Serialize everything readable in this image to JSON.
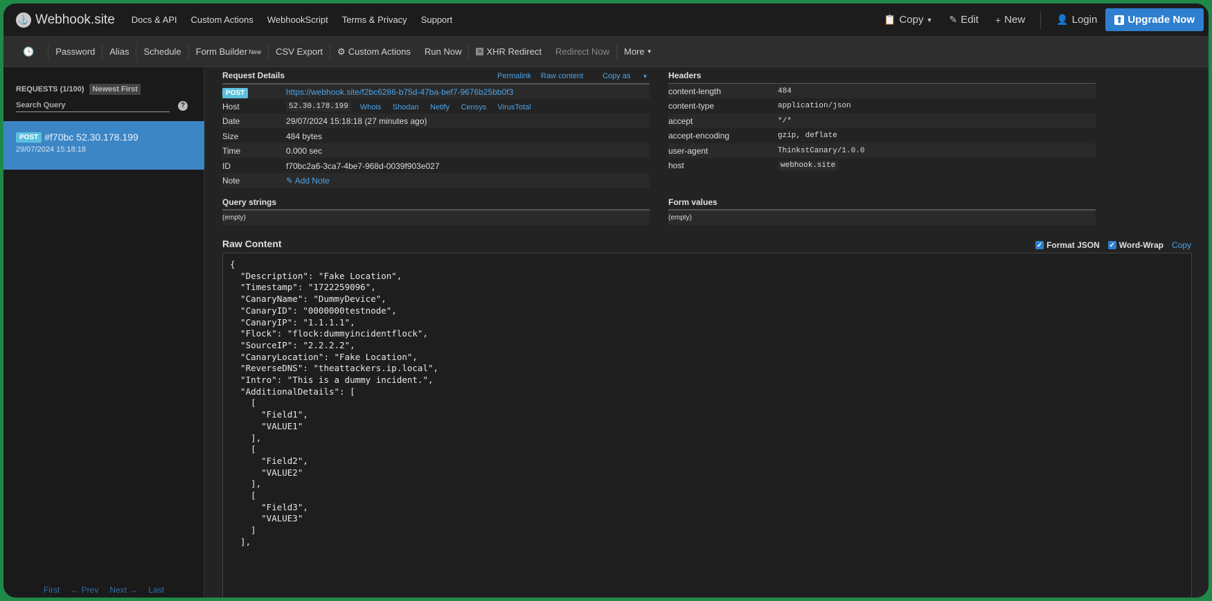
{
  "brand": {
    "name": "Webhook.site"
  },
  "nav": {
    "links": [
      "Docs & API",
      "Custom Actions",
      "WebhookScript",
      "Terms & Privacy",
      "Support"
    ],
    "copy": "Copy",
    "edit": "Edit",
    "new": "New",
    "login": "Login",
    "upgrade": "Upgrade Now"
  },
  "toolbar": {
    "password": "Password",
    "alias": "Alias",
    "schedule": "Schedule",
    "form_builder": "Form Builder",
    "form_builder_tag": "New",
    "csv_export": "CSV Export",
    "custom_actions": "Custom Actions",
    "run_now": "Run Now",
    "xhr_redirect": "XHR Redirect",
    "redirect_now": "Redirect Now",
    "more": "More"
  },
  "sidebar": {
    "requests_label": "REQUESTS (1/100)",
    "sort_label": "Newest First",
    "search_placeholder": "Search Query",
    "item": {
      "method": "POST",
      "title": "#f70bc 52.30.178.199",
      "date": "29/07/2024 15:18:18"
    },
    "pager": {
      "first": "First",
      "prev": "← Prev",
      "next": "Next →",
      "last": "Last"
    }
  },
  "request": {
    "title": "Request Details",
    "permalink": "Permalink",
    "raw_content": "Raw content",
    "copy_as": "Copy as",
    "method": "POST",
    "url": "https://webhook.site/f2bc6286-b75d-47ba-bef7-9676b25bb0f3",
    "host_label": "Host",
    "host": "52.30.178.199",
    "host_links": [
      "Whois",
      "Shodan",
      "Netify",
      "Censys",
      "VirusTotal"
    ],
    "date_label": "Date",
    "date": "29/07/2024 15:18:18 (27 minutes ago)",
    "size_label": "Size",
    "size": "484 bytes",
    "time_label": "Time",
    "time": "0.000 sec",
    "id_label": "ID",
    "id": "f70bc2a6-3ca7-4be7-968d-0039f903e027",
    "note_label": "Note",
    "add_note": "Add Note"
  },
  "headers": {
    "title": "Headers",
    "rows": [
      {
        "k": "content-length",
        "v": "484"
      },
      {
        "k": "content-type",
        "v": "application/json"
      },
      {
        "k": "accept",
        "v": "*/*"
      },
      {
        "k": "accept-encoding",
        "v": "gzip, deflate"
      },
      {
        "k": "user-agent",
        "v": "ThinkstCanary/1.0.0"
      },
      {
        "k": "host",
        "v": "webhook.site"
      }
    ]
  },
  "query": {
    "title": "Query strings",
    "empty": "(empty)"
  },
  "form": {
    "title": "Form values",
    "empty": "(empty)"
  },
  "raw": {
    "title": "Raw Content",
    "format_json": "Format JSON",
    "word_wrap": "Word-Wrap",
    "copy": "Copy",
    "content": "{\n  \"Description\": \"Fake Location\",\n  \"Timestamp\": \"1722259096\",\n  \"CanaryName\": \"DummyDevice\",\n  \"CanaryID\": \"0000000testnode\",\n  \"CanaryIP\": \"1.1.1.1\",\n  \"Flock\": \"flock:dummyincidentflock\",\n  \"SourceIP\": \"2.2.2.2\",\n  \"CanaryLocation\": \"Fake Location\",\n  \"ReverseDNS\": \"theattackers.ip.local\",\n  \"Intro\": \"This is a dummy incident.\",\n  \"AdditionalDetails\": [\n    [\n      \"Field1\",\n      \"VALUE1\"\n    ],\n    [\n      \"Field2\",\n      \"VALUE2\"\n    ],\n    [\n      \"Field3\",\n      \"VALUE3\"\n    ]\n  ],"
  },
  "colors": {
    "accent": "#2f7fd0",
    "selected": "#3d86c6",
    "link": "#4ba3e8",
    "frame": "#1f8a47"
  }
}
